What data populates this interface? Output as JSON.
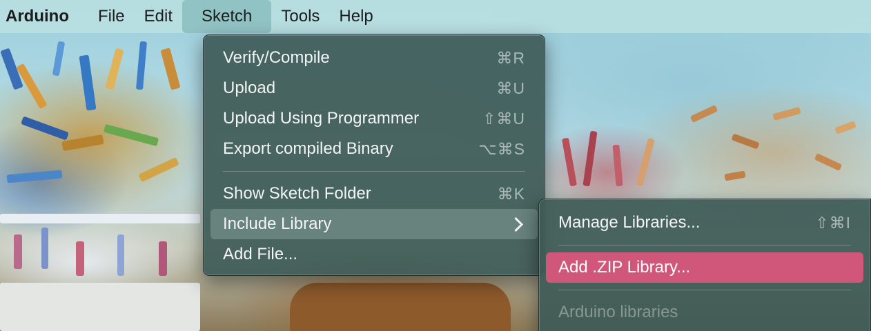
{
  "menubar": {
    "app": "Arduino",
    "items": [
      "File",
      "Edit",
      "Sketch",
      "Tools",
      "Help"
    ]
  },
  "sketch_menu": {
    "items": [
      {
        "label": "Verify/Compile",
        "shortcut": "⌘R"
      },
      {
        "label": "Upload",
        "shortcut": "⌘U"
      },
      {
        "label": "Upload Using Programmer",
        "shortcut": "⇧⌘U"
      },
      {
        "label": "Export compiled Binary",
        "shortcut": "⌥⌘S"
      },
      {
        "label": "Show Sketch Folder",
        "shortcut": "⌘K"
      },
      {
        "label": "Include Library",
        "shortcut": ""
      },
      {
        "label": "Add File...",
        "shortcut": ""
      }
    ]
  },
  "include_library_submenu": {
    "items": [
      {
        "label": "Manage Libraries...",
        "shortcut": "⇧⌘I"
      },
      {
        "label": "Add .ZIP Library...",
        "shortcut": ""
      },
      {
        "label": "Arduino libraries",
        "shortcut": ""
      }
    ]
  },
  "colors": {
    "menubar": "#b8dee0",
    "menu_bg": "#3e5a56",
    "selected": "#d0577a"
  }
}
